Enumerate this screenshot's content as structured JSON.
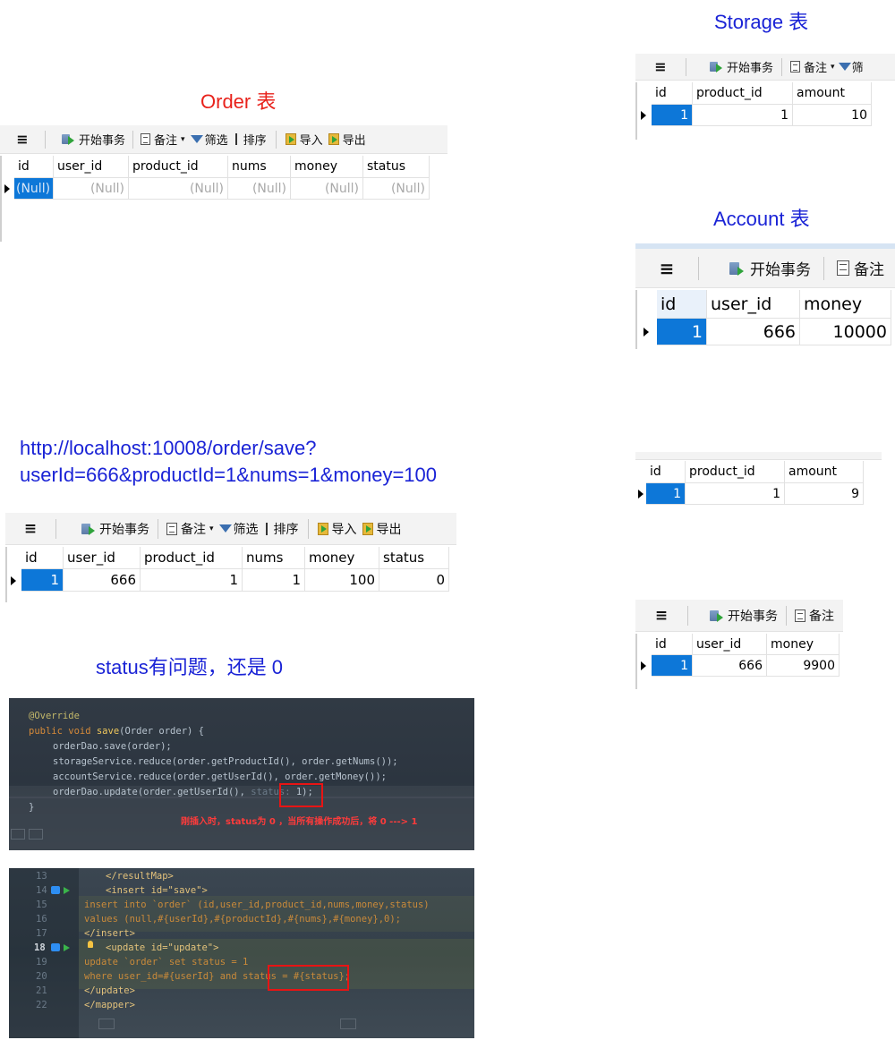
{
  "titles": {
    "order": "Order 表",
    "storage": "Storage 表",
    "account": "Account 表",
    "url_line1": "http://localhost:10008/order/save?",
    "url_line2": "userId=666&productId=1&nums=1&money=100",
    "status_issue": "status有问题，还是 0"
  },
  "toolbar": {
    "begin_tx": "开始事务",
    "note": "备注",
    "note_caret": "▾",
    "filter": "筛选",
    "sort": "排序",
    "import": "导入",
    "export": "导出",
    "export_cut": "导出",
    "filter_cut": "筛",
    "note_cut": "备注",
    "note_cut2": "备注",
    "menu": "≡"
  },
  "order_before": {
    "headers": [
      "id",
      "user_id",
      "product_id",
      "nums",
      "money",
      "status"
    ],
    "row": [
      "(Null)",
      "(Null)",
      "(Null)",
      "(Null)",
      "(Null)",
      "(Null)"
    ]
  },
  "storage_before": {
    "headers": [
      "id",
      "product_id",
      "amount"
    ],
    "row": [
      "1",
      "1",
      "10"
    ]
  },
  "account_before": {
    "headers": [
      "id",
      "user_id",
      "money"
    ],
    "row": [
      "1",
      "666",
      "10000"
    ]
  },
  "storage_after": {
    "headers": [
      "id",
      "product_id",
      "amount"
    ],
    "row": [
      "1",
      "1",
      "9"
    ]
  },
  "order_after": {
    "headers": [
      "id",
      "user_id",
      "product_id",
      "nums",
      "money",
      "status"
    ],
    "row": [
      "1",
      "666",
      "1",
      "1",
      "100",
      "0"
    ]
  },
  "account_after": {
    "headers": [
      "id",
      "user_id",
      "money"
    ],
    "row": [
      "1",
      "666",
      "9900"
    ]
  },
  "code1": {
    "annotation": "@Override",
    "l2_kw": "public void ",
    "l2_fn": "save",
    "l2_rest": "(Order order) {",
    "l3": "orderDao.save(order);",
    "l4": "storageService.reduce(order.getProductId(), order.getNums());",
    "l5": "accountService.reduce(order.getUserId(), order.getMoney());",
    "l6a": "orderDao.upd",
    "l6b": "ate(order.getUserId(), ",
    "l6hint": "status:",
    "l6c": " 1);",
    "l7": "}",
    "note": "刚插入时，status为 0 ，当所有操作成功后，将 0 ---> 1"
  },
  "code2": {
    "lines": [
      {
        "n": "13",
        "text": "</resultMap>"
      },
      {
        "n": "14",
        "text": "<insert id=\"save\">"
      },
      {
        "n": "15",
        "text": "insert into `order` (id,user_id,product_id,nums,money,status)"
      },
      {
        "n": "16",
        "text": "values (null,#{userId},#{productId},#{nums},#{money},0);"
      },
      {
        "n": "17",
        "text": "</insert>"
      },
      {
        "n": "18",
        "text": "<update id=\"update\">"
      },
      {
        "n": "19",
        "text": "update `order` set status = 1"
      },
      {
        "n": "20",
        "text": "where user_id=#{userId} and status = #{status};"
      },
      {
        "n": "21",
        "text": "</update>"
      },
      {
        "n": "22",
        "text": "</mapper>"
      }
    ]
  },
  "colors": {
    "selected_cell": "#0d77d8",
    "title_red": "#e8221b",
    "title_blue": "#1a23d6",
    "highlight_box": "#e81414"
  }
}
